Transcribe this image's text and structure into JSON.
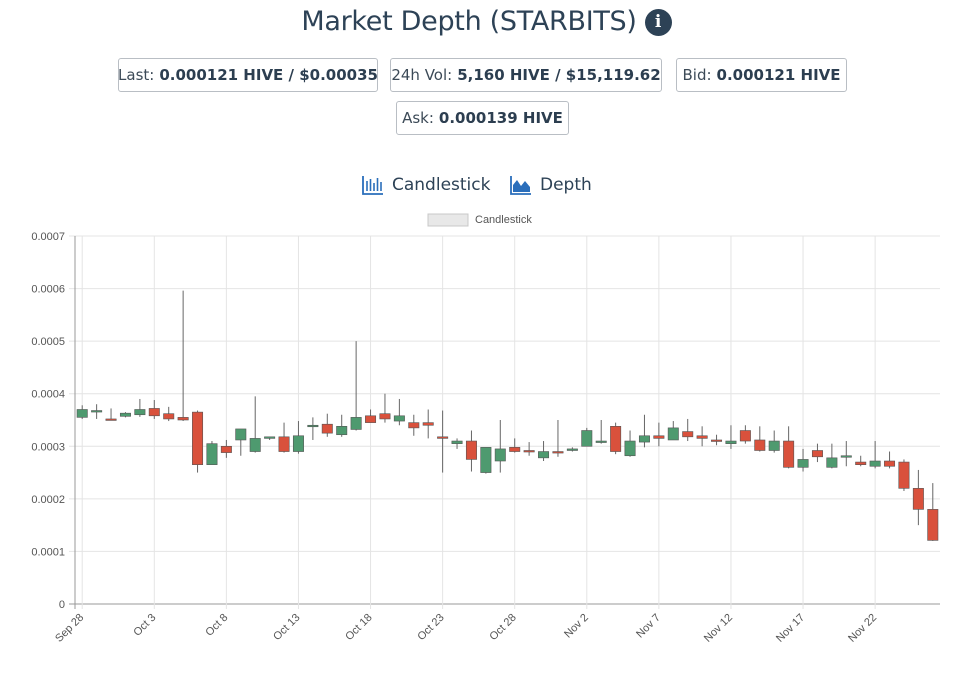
{
  "header": {
    "title": "Market Depth (STARBITS)",
    "info_icon": "info-circle-icon"
  },
  "stats": {
    "last_label": "Last:",
    "last_value": "0.000121 HIVE / $0.00035",
    "vol_label": "24h Vol:",
    "vol_value": "5,160 HIVE / $15,119.62",
    "bid_label": "Bid:",
    "bid_value": "0.000121 HIVE",
    "ask_label": "Ask:",
    "ask_value": "0.000139 HIVE"
  },
  "views": {
    "candlestick_label": "Candlestick",
    "candlestick_icon": "candlestick-chart-icon",
    "depth_label": "Depth",
    "depth_icon": "area-chart-icon"
  },
  "colors": {
    "up": "#4e9a6f",
    "down": "#d9513c",
    "accent": "#2a6ebb"
  },
  "chart_data": {
    "type": "candlestick",
    "legend": [
      "Candlestick"
    ],
    "legend_position": "top-center",
    "grid": true,
    "ylim": [
      0,
      0.0007
    ],
    "y_ticks": [
      "0",
      "0.0001",
      "0.0002",
      "0.0003",
      "0.0004",
      "0.0005",
      "0.0006",
      "0.0007"
    ],
    "x_tick_labels": [
      "Sep 28",
      "Oct 3",
      "Oct 8",
      "Oct 13",
      "Oct 18",
      "Oct 23",
      "Oct 28",
      "Nov 2",
      "Nov 7",
      "Nov 12",
      "Nov 17",
      "Nov 22"
    ],
    "dates": [
      "Sep 28",
      "Sep 29",
      "Sep 30",
      "Oct 1",
      "Oct 2",
      "Oct 3",
      "Oct 4",
      "Oct 5",
      "Oct 6",
      "Oct 7",
      "Oct 8",
      "Oct 9",
      "Oct 10",
      "Oct 11",
      "Oct 12",
      "Oct 13",
      "Oct 14",
      "Oct 15",
      "Oct 16",
      "Oct 17",
      "Oct 18",
      "Oct 19",
      "Oct 20",
      "Oct 21",
      "Oct 22",
      "Oct 23",
      "Oct 24",
      "Oct 25",
      "Oct 26",
      "Oct 27",
      "Oct 28",
      "Oct 29",
      "Oct 30",
      "Oct 31",
      "Nov 1",
      "Nov 2",
      "Nov 3",
      "Nov 4",
      "Nov 5",
      "Nov 6",
      "Nov 7",
      "Nov 8",
      "Nov 9",
      "Nov 10",
      "Nov 11",
      "Nov 12",
      "Nov 13",
      "Nov 14",
      "Nov 15",
      "Nov 16",
      "Nov 17",
      "Nov 18",
      "Nov 19",
      "Nov 20",
      "Nov 21",
      "Nov 22",
      "Nov 23",
      "Nov 24",
      "Nov 25",
      "Nov 26"
    ],
    "open": [
      0.000355,
      0.000368,
      0.000352,
      0.000357,
      0.00036,
      0.000372,
      0.000362,
      0.000355,
      0.000365,
      0.000265,
      0.0003,
      0.000312,
      0.00029,
      0.000315,
      0.000318,
      0.00029,
      0.000338,
      0.000342,
      0.000322,
      0.000332,
      0.000358,
      0.000362,
      0.000348,
      0.000345,
      0.000345,
      0.000318,
      0.000305,
      0.00031,
      0.00025,
      0.000272,
      0.000298,
      0.000292,
      0.000278,
      0.00029,
      0.000292,
      0.0003,
      0.00031,
      0.000338,
      0.000282,
      0.000308,
      0.00032,
      0.000312,
      0.000328,
      0.00032,
      0.000312,
      0.000305,
      0.00033,
      0.000312,
      0.000292,
      0.00031,
      0.00026,
      0.000292,
      0.00026,
      0.00028,
      0.00027,
      0.000262,
      0.000272,
      0.00027,
      0.00022,
      0.00018
    ],
    "high": [
      0.000378,
      0.00038,
      0.000372,
      0.000365,
      0.00039,
      0.000388,
      0.000375,
      0.000596,
      0.000368,
      0.00031,
      0.000312,
      0.00033,
      0.000395,
      0.000318,
      0.000345,
      0.000348,
      0.000355,
      0.000362,
      0.00036,
      0.0005,
      0.00037,
      0.0004,
      0.00039,
      0.00036,
      0.00037,
      0.000368,
      0.000315,
      0.00033,
      0.000298,
      0.00035,
      0.000315,
      0.000308,
      0.00031,
      0.00035,
      0.000298,
      0.000335,
      0.00035,
      0.000345,
      0.00033,
      0.00036,
      0.000345,
      0.000348,
      0.000352,
      0.000338,
      0.000322,
      0.00034,
      0.00034,
      0.000338,
      0.00033,
      0.000338,
      0.000295,
      0.000305,
      0.000305,
      0.00031,
      0.000282,
      0.00031,
      0.00029,
      0.000275,
      0.000255,
      0.00023
    ],
    "low": [
      0.000352,
      0.000352,
      0.00035,
      0.000355,
      0.000356,
      0.000352,
      0.000348,
      0.000348,
      0.00025,
      0.000265,
      0.000278,
      0.000282,
      0.000288,
      0.000312,
      0.000288,
      0.000286,
      0.000312,
      0.000318,
      0.000318,
      0.00033,
      0.000345,
      0.000345,
      0.00034,
      0.00032,
      0.000315,
      0.00025,
      0.000295,
      0.000252,
      0.000248,
      0.00025,
      0.000288,
      0.000282,
      0.000272,
      0.00028,
      0.00029,
      0.0003,
      0.000305,
      0.000285,
      0.00028,
      0.000298,
      0.0003,
      0.000312,
      0.00031,
      0.0003,
      0.000302,
      0.000295,
      0.000305,
      0.00029,
      0.000288,
      0.000258,
      0.000252,
      0.00027,
      0.000258,
      0.000262,
      0.000262,
      0.000258,
      0.000258,
      0.000215,
      0.00015,
      0.00012
    ],
    "close": [
      0.00037,
      0.000368,
      0.00035,
      0.000363,
      0.00037,
      0.000358,
      0.000352,
      0.00035,
      0.000265,
      0.000305,
      0.000288,
      0.000333,
      0.000315,
      0.000318,
      0.00029,
      0.00032,
      0.00034,
      0.000325,
      0.000338,
      0.000355,
      0.000345,
      0.000352,
      0.000358,
      0.000335,
      0.00034,
      0.000315,
      0.00031,
      0.000275,
      0.000298,
      0.000295,
      0.00029,
      0.00029,
      0.00029,
      0.000288,
      0.000295,
      0.00033,
      0.00031,
      0.00029,
      0.00031,
      0.00032,
      0.000315,
      0.000335,
      0.000318,
      0.000315,
      0.00031,
      0.00031,
      0.00031,
      0.000292,
      0.00031,
      0.00026,
      0.000275,
      0.00028,
      0.000278,
      0.000282,
      0.000265,
      0.000272,
      0.000262,
      0.00022,
      0.00018,
      0.000121
    ]
  }
}
